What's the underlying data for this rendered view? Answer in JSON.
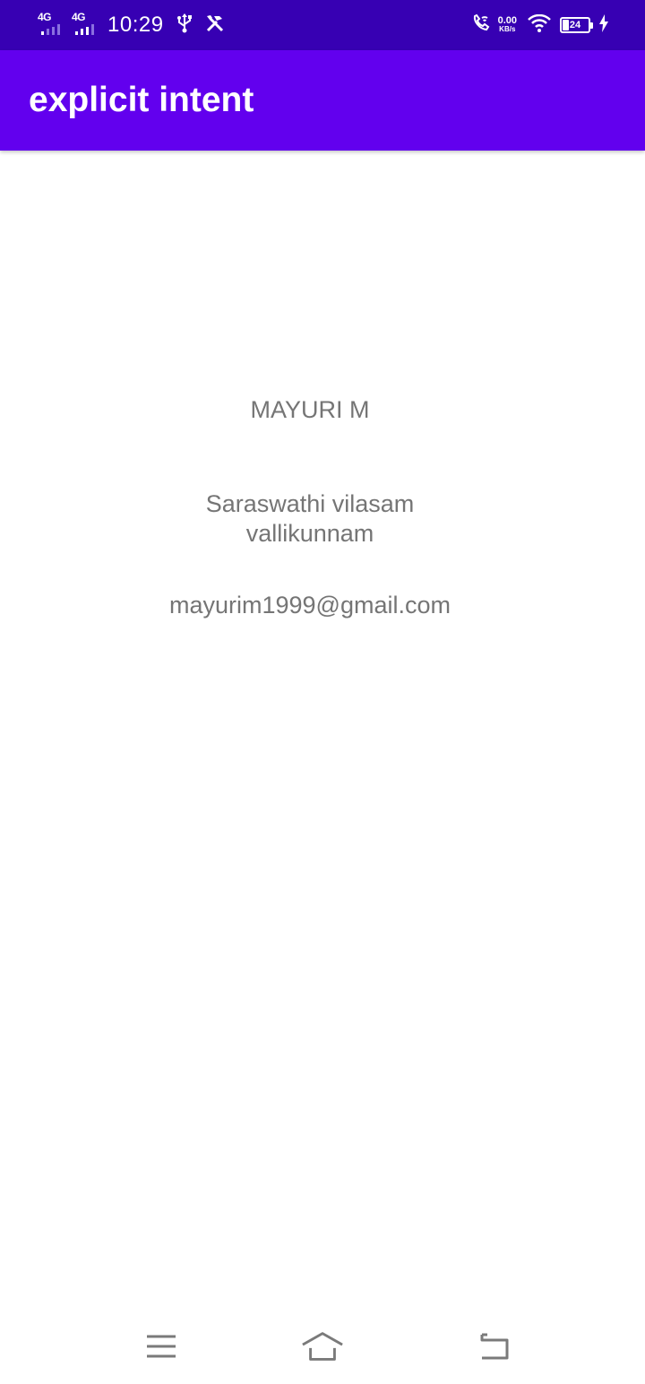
{
  "status_bar": {
    "sim1_network": "4G",
    "sim2_network": "4G",
    "time": "10:29",
    "speed_value": "0.00",
    "speed_unit": "KB/s",
    "battery_level": "24",
    "battery_percent": 24,
    "icons": [
      "usb-icon",
      "developer-tools-icon",
      "wifi-calling-icon",
      "wifi-icon",
      "battery-icon",
      "charging-bolt-icon"
    ]
  },
  "app_bar": {
    "title": "explicit intent"
  },
  "details": {
    "name": "MAYURI M",
    "address_line1": "Saraswathi vilasam",
    "address_line2": "vallikunnam",
    "email": "mayurim1999@gmail.com"
  },
  "nav_bar": {
    "icons": [
      "menu-icon",
      "home-icon",
      "back-icon"
    ]
  },
  "colors": {
    "status_bar": "#3700b3",
    "app_bar": "#6200ee",
    "text": "#757575",
    "nav_icons": "#7a7a7a"
  }
}
